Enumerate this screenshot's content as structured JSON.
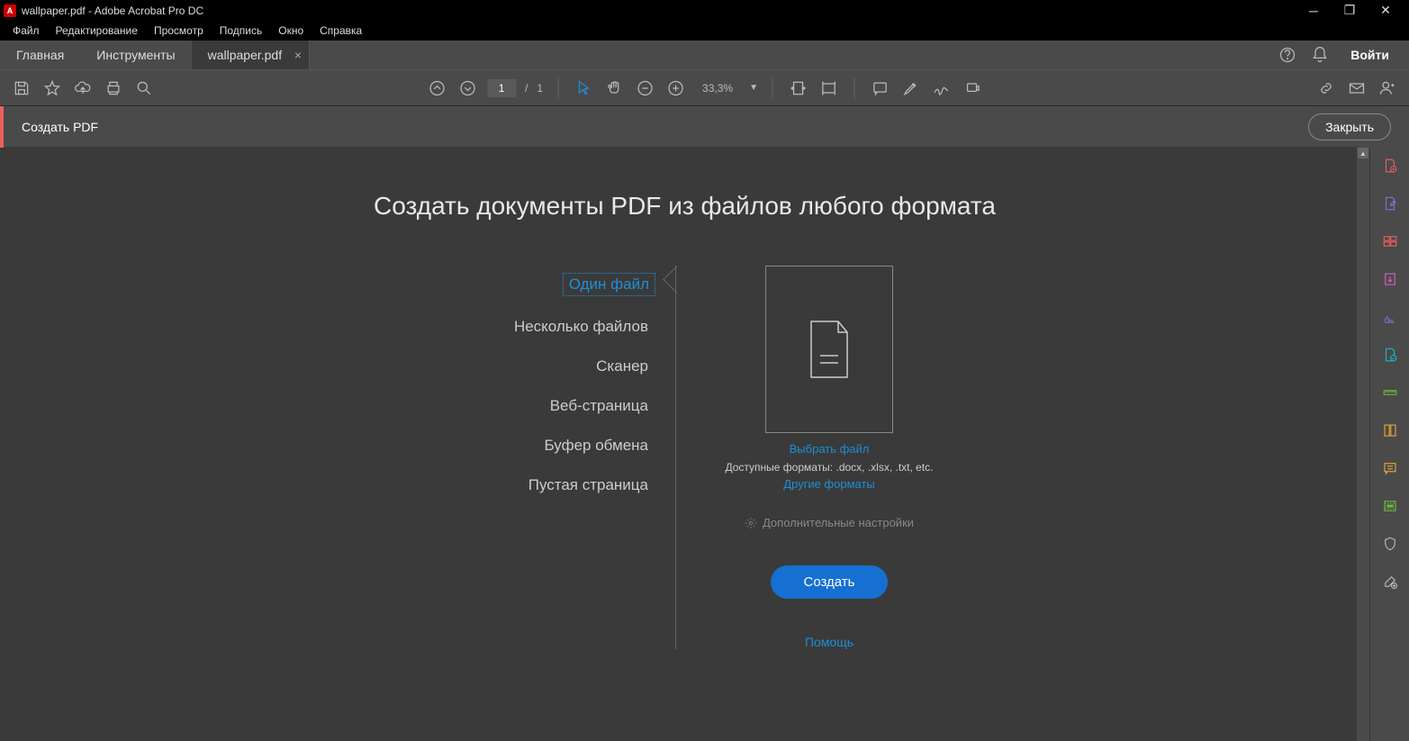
{
  "window": {
    "title": "wallpaper.pdf - Adobe Acrobat Pro DC"
  },
  "menu": [
    "Файл",
    "Редактирование",
    "Просмотр",
    "Подпись",
    "Окно",
    "Справка"
  ],
  "tabs": {
    "home": "Главная",
    "tools": "Инструменты",
    "doc": "wallpaper.pdf",
    "signin": "Войти"
  },
  "toolbar": {
    "page_current": "1",
    "page_sep": "/",
    "page_total": "1",
    "zoom": "33,3%"
  },
  "subheader": {
    "title": "Создать PDF",
    "close": "Закрыть"
  },
  "panel": {
    "title": "Создать документы PDF из файлов любого формата",
    "sources": [
      "Один файл",
      "Несколько файлов",
      "Сканер",
      "Веб-страница",
      "Буфер обмена",
      "Пустая страница"
    ],
    "select_file": "Выбрать файл",
    "available": "Доступные форматы: .docx, .xlsx, .txt, etc.",
    "more_formats": "Другие форматы",
    "advanced": "Дополнительные настройки",
    "create_btn": "Создать",
    "help": "Помощь"
  }
}
